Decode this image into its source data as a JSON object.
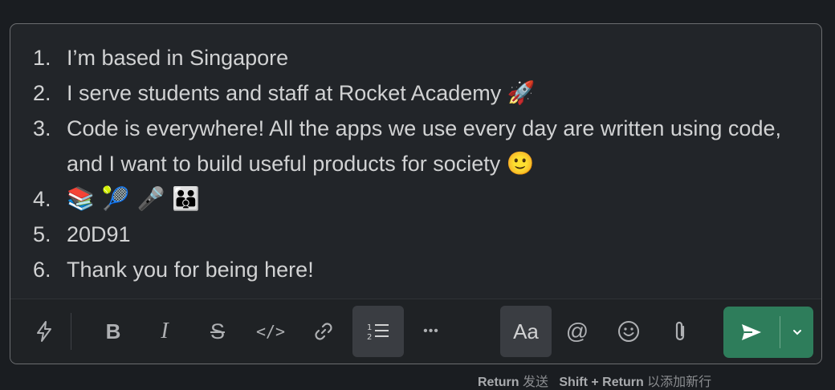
{
  "editor": {
    "items": [
      {
        "num": "1.",
        "text": "I’m based in Singapore",
        "emoji": ""
      },
      {
        "num": "2.",
        "text": "I serve students and staff at Rocket Academy",
        "emoji": "🚀"
      },
      {
        "num": "3.",
        "text": "Code is everywhere! All the apps we use every day are written using code, and I want to build useful products for society",
        "emoji": "🙂"
      },
      {
        "num": "4.",
        "text": "",
        "emoji": "📚 🎾 🎤 👨‍👨‍👦"
      },
      {
        "num": "5.",
        "text": "20D91",
        "emoji": ""
      },
      {
        "num": "6.",
        "text": "Thank you for being here!",
        "emoji": ""
      }
    ]
  },
  "toolbar": {
    "bold_label": "B",
    "italic_label": "I",
    "strike_label": "S",
    "code_label": "</>",
    "more_label": "•••",
    "text_format_label": "Aa"
  },
  "footer": {
    "hint_key1": "Return",
    "hint_action1": "发送",
    "hint_key2": "Shift + Return",
    "hint_action2": "以添加新行"
  },
  "colors": {
    "background": "#1a1d21",
    "composer": "#222529",
    "send": "#2e7d5b",
    "text": "#d1d2d3"
  }
}
